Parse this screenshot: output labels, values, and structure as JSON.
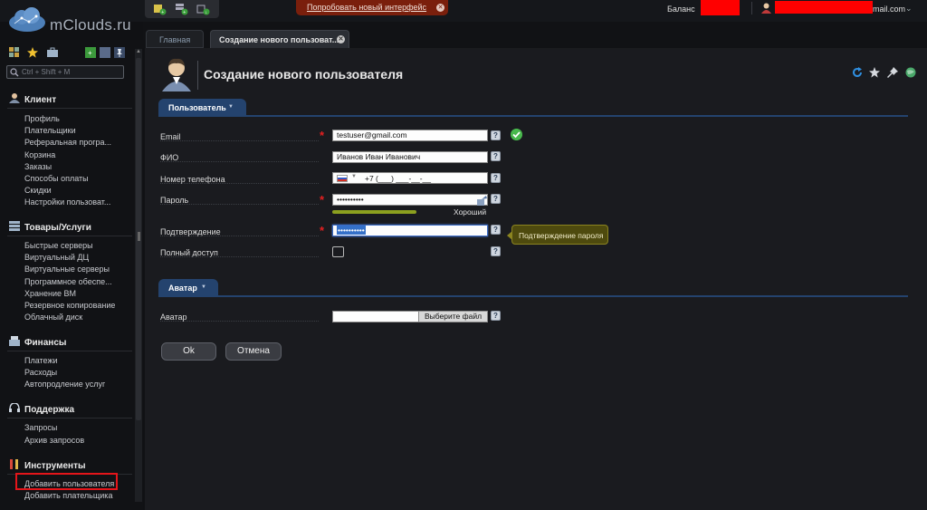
{
  "app": {
    "brand": "mClouds.ru",
    "colors": {
      "accent": "#24436e",
      "required": "#e42020",
      "tooltip": "#4e4a0e",
      "redact": "#ff0000"
    }
  },
  "topbar": {
    "quick_icons": [
      "add-server-icon",
      "add-service-icon",
      "download-icon"
    ],
    "try_new_interface": "Попробовать новый интерфейс",
    "balance_label": "Баланс",
    "user_email_suffix": "mail.com"
  },
  "sidebar": {
    "tool_icons": [
      "grid-icon",
      "star-icon",
      "briefcase-icon",
      "green-square-icon",
      "blue-square-icon",
      "pin-icon"
    ],
    "search_placeholder": "Ctrl + Shift + M",
    "sections": [
      {
        "title": "Клиент",
        "icon": "user-icon",
        "items": [
          "Профиль",
          "Плательщики",
          "Реферальная програ...",
          "Корзина",
          "Заказы",
          "Способы оплаты",
          "Скидки",
          "Настройки пользоват..."
        ]
      },
      {
        "title": "Товары/Услуги",
        "icon": "servers-icon",
        "items": [
          "Быстрые серверы",
          "Виртуальный ДЦ",
          "Виртуальные серверы",
          "Программное обеспе...",
          "Хранение ВМ",
          "Резервное копирование",
          "Облачный диск"
        ]
      },
      {
        "title": "Финансы",
        "icon": "cash-register-icon",
        "items": [
          "Платежи",
          "Расходы",
          "Автопродление услуг"
        ]
      },
      {
        "title": "Поддержка",
        "icon": "headset-icon",
        "items": [
          "Запросы",
          "Архив запросов"
        ]
      },
      {
        "title": "Инструменты",
        "icon": "tools-icon",
        "items": [
          "Добавить пользователя",
          "Добавить плательщика"
        ]
      }
    ]
  },
  "tabs": {
    "main": "Главная",
    "create_user": "Создание нового пользоват..."
  },
  "page": {
    "title": "Создание нового пользователя",
    "toolbar_icons": [
      "refresh-icon",
      "star-icon",
      "pin-icon",
      "globe-icon"
    ],
    "section_user": "Пользователь",
    "section_avatar": "Аватар",
    "fields": {
      "email": {
        "label": "Email",
        "value": "testuser@gmail.com"
      },
      "fio": {
        "label": "ФИО",
        "value": "Иванов Иван Иванович"
      },
      "phone": {
        "label": "Номер телефона",
        "value": "+7 (___) ___-__-__"
      },
      "password": {
        "label": "Пароль",
        "value": "••••••••••",
        "strength_label": "Хороший",
        "strength": 0.6
      },
      "confirm": {
        "label": "Подтверждение",
        "value": "••••••••••"
      },
      "full_access": {
        "label": "Полный доступ",
        "checked": false
      },
      "avatar": {
        "label": "Аватар",
        "button": "Выберите файл"
      }
    },
    "tooltip": "Подтверждение пароля",
    "help_glyph": "?",
    "ok_button": "Ok",
    "cancel_button": "Отмена"
  }
}
